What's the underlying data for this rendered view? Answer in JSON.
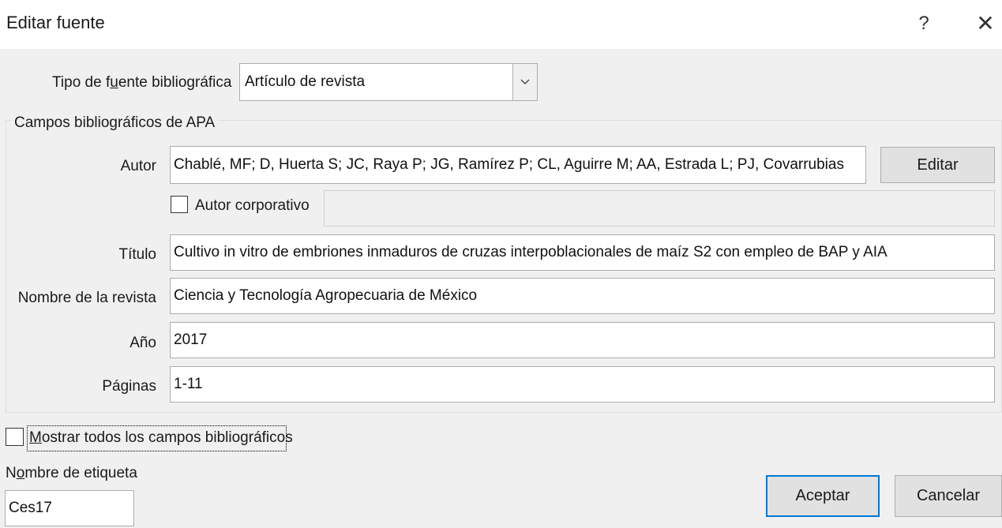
{
  "dialog": {
    "title": "Editar fuente",
    "help_glyph": "?",
    "close_glyph": "✕"
  },
  "source_type": {
    "label_pre": "Tipo de f",
    "label_accel": "u",
    "label_post": "ente bibliográfica",
    "value": "Artículo de revista"
  },
  "group": {
    "legend": "Campos bibliográficos de APA"
  },
  "fields": {
    "autor": {
      "label": "Autor",
      "value": "Chablé, MF; D, Huerta S; JC, Raya P; JG, Ramírez P; CL, Aguirre M; AA, Estrada L; PJ, Covarrubias"
    },
    "editar_button": "Editar",
    "autor_corporativo": {
      "label": "Autor corporativo",
      "checked": false,
      "value": ""
    },
    "titulo": {
      "label": "Título",
      "value": "Cultivo in vitro de embriones inmaduros de cruzas interpoblacionales de maíz S2 con empleo de BAP y AIA"
    },
    "revista": {
      "label": "Nombre de la revista",
      "value": "Ciencia y Tecnología Agropecuaria de México"
    },
    "anio": {
      "label": "Año",
      "value": "2017"
    },
    "paginas": {
      "label": "Páginas",
      "value": "1-11"
    }
  },
  "show_all": {
    "label_accel": "M",
    "label_post": "ostrar todos los campos bibliográficos",
    "checked": false
  },
  "tag_name": {
    "label_pre": "N",
    "label_accel": "o",
    "label_post": "mbre de etiqueta",
    "value": "Ces17"
  },
  "buttons": {
    "accept": "Aceptar",
    "cancel": "Cancelar"
  },
  "icons": {
    "help": "help-icon",
    "close": "close-icon",
    "dropdown": "chevron-down-icon"
  },
  "colors": {
    "dialog_bg": "#f0f0f0",
    "default_button_border": "#0078d7"
  }
}
